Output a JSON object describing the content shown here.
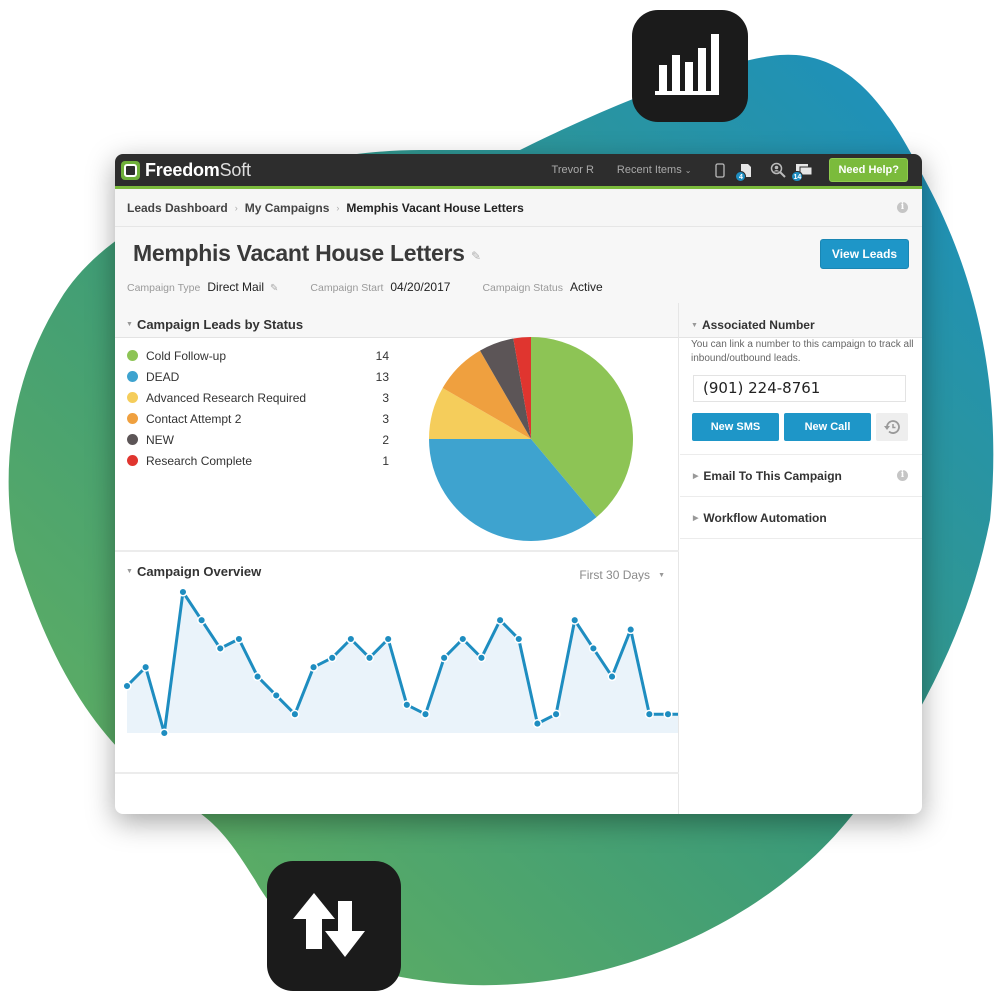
{
  "app": {
    "brand": "Freedom",
    "brand_suffix": "Soft",
    "user": "Trevor R",
    "recent_items": "Recent Items",
    "need_help": "Need Help?",
    "icons": [
      {
        "name": "mobile-icon",
        "badge": null
      },
      {
        "name": "document-icon",
        "badge": "4"
      },
      {
        "name": "search-user-icon",
        "badge": null
      },
      {
        "name": "chat-icon",
        "badge": "14"
      }
    ]
  },
  "breadcrumb": {
    "items": [
      "Leads Dashboard",
      "My Campaigns"
    ],
    "current": "Memphis Vacant House Letters",
    "separator": "›"
  },
  "header": {
    "title": "Memphis Vacant House Letters",
    "campaign_type_label": "Campaign Type",
    "campaign_type": "Direct Mail",
    "campaign_start_label": "Campaign Start",
    "campaign_start": "04/20/2017",
    "campaign_status_label": "Campaign Status",
    "campaign_status": "Active",
    "view_leads": "View Leads"
  },
  "leads_by_status": {
    "title": "Campaign Leads by Status",
    "items": [
      {
        "label": "Cold Follow-up",
        "count": "14",
        "color": "#8dc455"
      },
      {
        "label": "DEAD",
        "count": "13",
        "color": "#3ea3cf"
      },
      {
        "label": "Advanced Research Required",
        "count": "3",
        "color": "#f5cd5b"
      },
      {
        "label": "Contact Attempt 2",
        "count": "3",
        "color": "#efa03f"
      },
      {
        "label": "NEW",
        "count": "2",
        "color": "#5c5557"
      },
      {
        "label": "Research Complete",
        "count": "1",
        "color": "#e0352f"
      }
    ]
  },
  "overview": {
    "title": "Campaign Overview",
    "range": "First 30 Days"
  },
  "associated_number": {
    "title": "Associated Number",
    "description": "You can link a number to this campaign to track all inbound/outbound leads.",
    "phone": "(901) 224-8761",
    "new_sms": "New SMS",
    "new_call": "New Call"
  },
  "accordion": {
    "email": "Email To This Campaign",
    "workflow": "Workflow Automation"
  },
  "colors": {
    "accent_blue": "#1e96c8",
    "accent_green": "#7bbb3c",
    "topbar": "#2d2d2d"
  },
  "chart_data": [
    {
      "type": "pie",
      "title": "Campaign Leads by Status",
      "categories": [
        "Cold Follow-up",
        "DEAD",
        "Advanced Research Required",
        "Contact Attempt 2",
        "NEW",
        "Research Complete"
      ],
      "values": [
        14,
        13,
        3,
        3,
        2,
        1
      ],
      "colors": [
        "#8dc455",
        "#3ea3cf",
        "#f5cd5b",
        "#efa03f",
        "#5c5557",
        "#e0352f"
      ],
      "legend": "left"
    },
    {
      "type": "area",
      "title": "Campaign Overview",
      "xlabel": "",
      "ylabel": "",
      "x": [
        1,
        2,
        3,
        4,
        5,
        6,
        7,
        8,
        9,
        10,
        11,
        12,
        13,
        14,
        15,
        16,
        17,
        18,
        19,
        20,
        21,
        22,
        23,
        24,
        25,
        26,
        27,
        28,
        29,
        30
      ],
      "values": [
        5,
        7,
        0,
        15,
        12,
        9,
        10,
        6,
        4,
        2,
        7,
        8,
        10,
        8,
        10,
        3,
        2,
        8,
        10,
        8,
        12,
        10,
        1,
        2,
        12,
        9,
        6,
        11,
        2,
        2
      ],
      "ylim": [
        0,
        15
      ],
      "grid": false,
      "color": "#1e8dc0",
      "fill": "#eaf3fa"
    }
  ]
}
